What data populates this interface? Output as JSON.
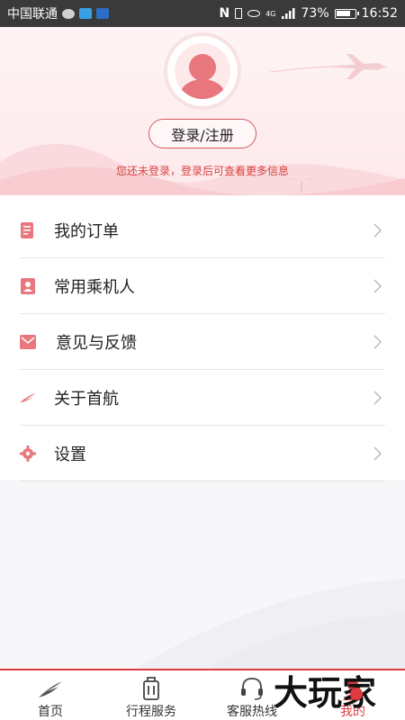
{
  "status_bar": {
    "carrier": "中国联通",
    "network": "4G",
    "battery": "73%",
    "time": "16:52"
  },
  "profile": {
    "login_button": "登录/注册",
    "login_hint": "您还未登录，登录后可查看更多信息"
  },
  "menu": {
    "items": [
      {
        "label": "我的订单",
        "icon": "order-icon"
      },
      {
        "label": "常用乘机人",
        "icon": "passenger-icon"
      },
      {
        "label": "意见与反馈",
        "icon": "feedback-icon"
      },
      {
        "label": "关于首航",
        "icon": "airline-logo-icon"
      },
      {
        "label": "设置",
        "icon": "gear-icon"
      }
    ]
  },
  "bottom_nav": {
    "items": [
      {
        "label": "首页",
        "icon": "home-logo-icon"
      },
      {
        "label": "行程服务",
        "icon": "luggage-icon"
      },
      {
        "label": "客服热线",
        "icon": "headset-icon"
      },
      {
        "label": "我的",
        "icon": "user-icon",
        "active": true
      }
    ]
  },
  "watermark": {
    "text": "大玩家"
  },
  "colors": {
    "accent": "#e03a41",
    "icon": "#e8777e",
    "status_bar": "#3a3a3a"
  }
}
